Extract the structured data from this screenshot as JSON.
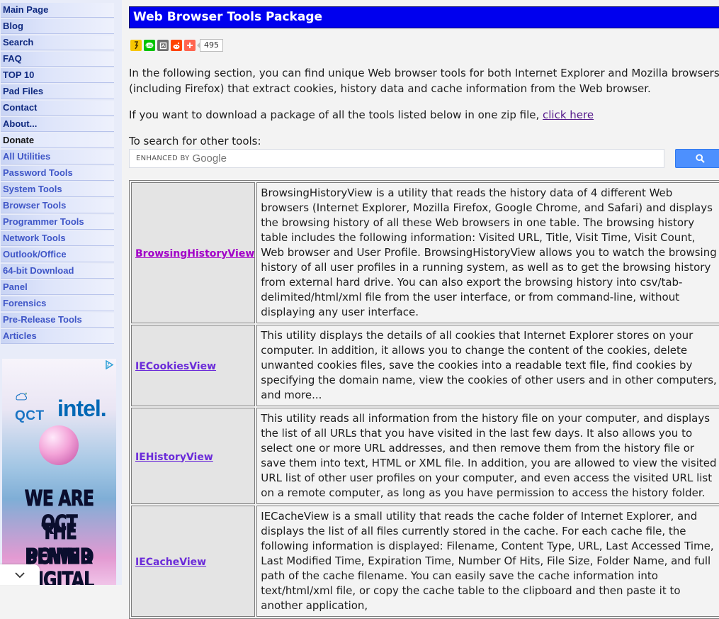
{
  "sidebar": {
    "menu": [
      {
        "label": "Main Page",
        "style": "dark"
      },
      {
        "label": "Blog",
        "style": "dark"
      },
      {
        "label": "Search",
        "style": "dark"
      },
      {
        "label": "FAQ",
        "style": "dark"
      },
      {
        "label": "TOP 10",
        "style": "dark"
      },
      {
        "label": "Pad Files",
        "style": "dark"
      },
      {
        "label": "Contact",
        "style": "dark"
      },
      {
        "label": "About...",
        "style": "dark"
      },
      {
        "label": "Donate",
        "style": "current"
      },
      {
        "label": "All Utilities",
        "style": "muted"
      },
      {
        "label": "Password Tools",
        "style": "muted"
      },
      {
        "label": "System Tools",
        "style": "muted"
      },
      {
        "label": "Browser Tools",
        "style": "muted"
      },
      {
        "label": "Programmer Tools",
        "style": "muted"
      },
      {
        "label": "Network Tools",
        "style": "muted"
      },
      {
        "label": "Outlook/Office",
        "style": "muted"
      },
      {
        "label": "64-bit Download",
        "style": "muted"
      },
      {
        "label": "Panel",
        "style": "muted"
      },
      {
        "label": "Forensics",
        "style": "muted"
      },
      {
        "label": "Pre-Release Tools",
        "style": "muted"
      },
      {
        "label": "Articles",
        "style": "muted"
      }
    ],
    "ad": {
      "brand_1": "QCT",
      "brand_2": "intel.",
      "lines": [
        "WE ARE QCT",
        "THE POWER",
        "BEHIND",
        "DIGITAL"
      ]
    }
  },
  "main": {
    "title": "Web Browser Tools Package",
    "share": {
      "count": "495",
      "icons": [
        "kakaostory-icon",
        "line-icon",
        "band-icon",
        "reddit-icon",
        "more-share-icon"
      ]
    },
    "intro": "In the following section, you can find unique Web browser tools for both Internet Explorer and Mozilla browsers (including Firefox) that extract cookies, history data and cache information from the Web browser.",
    "download_prefix": "If you want to download a package of all the tools listed below in one zip file, ",
    "download_link": "click here",
    "search_label": "To search for other tools:",
    "search": {
      "brand_prefix": "ENHANCED BY",
      "brand_name": "Google"
    },
    "tools": [
      {
        "name": "BrowsingHistoryView",
        "link_state": "visited",
        "description": "BrowsingHistoryView is a utility that reads the history data of 4 different Web browsers (Internet Explorer, Mozilla Firefox, Google Chrome, and Safari) and displays the browsing history of all these Web browsers in one table. The browsing history table includes the following information: Visited URL, Title, Visit Time, Visit Count, Web browser and User Profile. BrowsingHistoryView allows you to watch the browsing history of all user profiles in a running system, as well as to get the browsing history from external hard drive. You can also export the browsing history into csv/tab-delimited/html/xml file from the user interface, or from command-line, without displaying any user interface."
      },
      {
        "name": "IECookiesView",
        "link_state": "normal",
        "description": "This utility displays the details of all cookies that Internet Explorer stores on your computer. In addition, it allows you to change the content of the cookies, delete unwanted cookies files, save the cookies into a readable text file, find cookies by specifying the domain name, view the cookies of other users and in other computers, and more..."
      },
      {
        "name": "IEHistoryView",
        "link_state": "normal",
        "description": "This utility reads all information from the history file on your computer, and displays the list of all URLs that you have visited in the last few days. It also allows you to select one or more URL addresses, and then remove them from the history file or save them into text, HTML or XML file. In addition, you are allowed to view the visited URL list of other user profiles on your computer, and even access the visited URL list on a remote computer, as long as you have permission to access the history folder."
      },
      {
        "name": "IECacheView",
        "link_state": "normal",
        "description": "IECacheView is a small utility that reads the cache folder of Internet Explorer, and displays the list of all files currently stored in the cache. For each cache file, the following information is displayed: Filename, Content Type, URL, Last Accessed Time, Last Modified Time, Expiration Time, Number Of Hits, File Size, Folder Name, and full path of the cache filename. You can easily save the cache information into text/html/xml file, or copy the cache table to the clipboard and then paste it to another application,"
      }
    ]
  }
}
